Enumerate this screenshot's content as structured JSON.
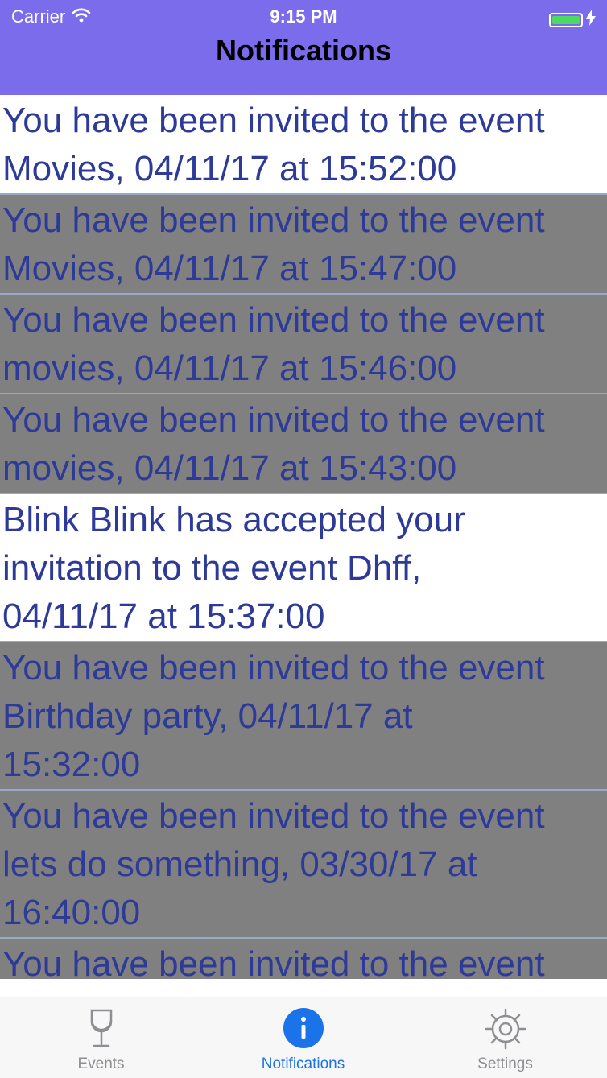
{
  "status_bar": {
    "carrier": "Carrier",
    "time": "9:15 PM"
  },
  "nav": {
    "title": "Notifications"
  },
  "notifications": [
    {
      "lines": [
        "You have been invited to the event",
        "Movies, 04/11/17 at 15:52:00"
      ],
      "read": false
    },
    {
      "lines": [
        "You have been invited to the event",
        "Movies, 04/11/17 at 15:47:00"
      ],
      "read": true
    },
    {
      "lines": [
        "You have been invited to the event",
        "movies, 04/11/17 at 15:46:00"
      ],
      "read": true
    },
    {
      "lines": [
        "You have been invited to the event",
        "movies, 04/11/17 at 15:43:00"
      ],
      "read": true
    },
    {
      "lines": [
        "Blink Blink has accepted your",
        "invitation to the event Dhff,",
        "04/11/17 at 15:37:00"
      ],
      "read": false
    },
    {
      "lines": [
        "You have been invited to the event",
        "Birthday party, 04/11/17 at",
        "15:32:00"
      ],
      "read": true
    },
    {
      "lines": [
        "You have been invited to the event",
        "lets do something, 03/30/17 at",
        "16:40:00"
      ],
      "read": true
    },
    {
      "lines": [
        "You have been invited to the event"
      ],
      "read": true
    }
  ],
  "tabs": [
    {
      "label": "Events",
      "icon": "wine-glass-icon",
      "active": false
    },
    {
      "label": "Notifications",
      "icon": "info-icon",
      "active": true
    },
    {
      "label": "Settings",
      "icon": "gear-icon",
      "active": false
    }
  ],
  "colors": {
    "bar": "#7b6cec",
    "text": "#2d3a98",
    "read_row": "#808080",
    "tab_active": "#1a73e8"
  }
}
